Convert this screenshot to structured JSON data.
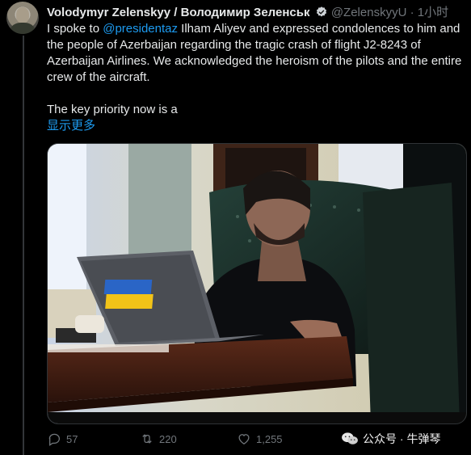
{
  "tweet": {
    "author_name": "Volodymyr Zelenskyy / Володимир Зеленськ",
    "handle": "@ZelenskyyU",
    "separator": "·",
    "time": "1小时",
    "text_part1": "I spoke to ",
    "mention": "@presidentaz",
    "text_part2": " Ilham Aliyev and expressed condolences to him and the people of Azerbaijan regarding the tragic crash of flight J2-8243 of Azerbaijan Airlines. We acknowledged the heroism of the pilots and the entire crew of the aircraft.",
    "text_part3": "The key priority now is a",
    "show_more": "显示更多"
  },
  "actions": {
    "replies": "57",
    "retweets": "220",
    "likes": "1,255"
  },
  "watermark": {
    "text": "公众号 · 牛弹琴"
  },
  "colors": {
    "background": "#000000",
    "text": "#e7e9ea",
    "muted": "#71767b",
    "accent": "#1d9bf0",
    "flag_blue": "#2a65c6",
    "flag_yellow": "#f2c318"
  },
  "icons": {
    "verified": "verified-badge-icon",
    "reply": "reply-icon",
    "retweet": "retweet-icon",
    "like": "heart-icon",
    "watermark": "wechat-icon"
  }
}
